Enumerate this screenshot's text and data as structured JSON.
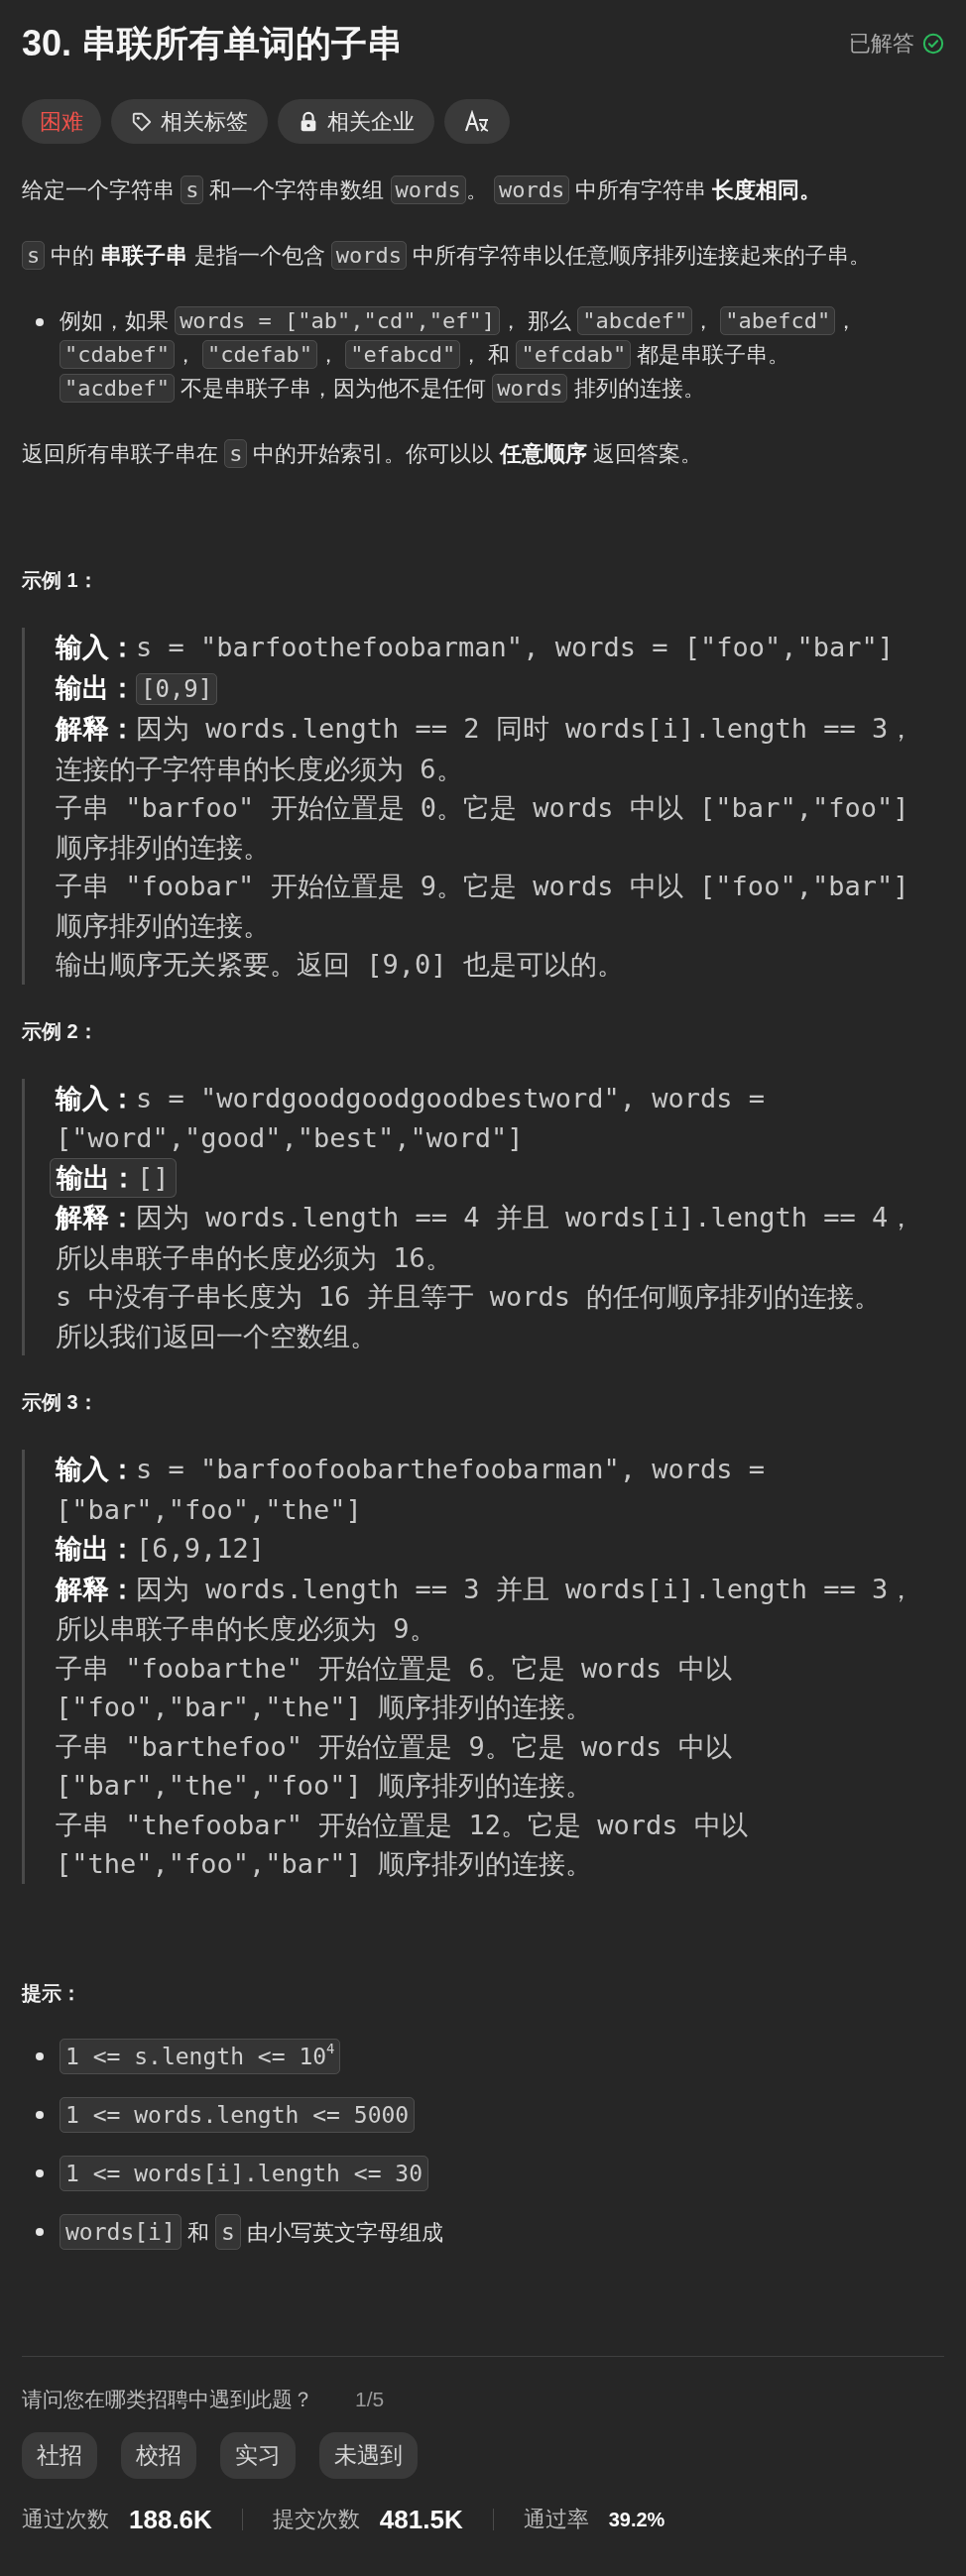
{
  "title": "30. 串联所有单词的子串",
  "status": "已解答",
  "tags": [
    {
      "kind": "difficulty",
      "label": "困难"
    },
    {
      "kind": "topics",
      "label": "相关标签"
    },
    {
      "kind": "companies",
      "label": "相关企业"
    },
    {
      "kind": "translate"
    }
  ],
  "description": [
    {
      "kind": "paragraph",
      "segments": [
        {
          "kind": "text",
          "text": "给定一个字符串 "
        },
        {
          "kind": "code",
          "text": "s"
        },
        {
          "kind": "text",
          "text": " 和一个字符串数组 "
        },
        {
          "kind": "code",
          "text": "words"
        },
        {
          "kind": "text",
          "text": "。 "
        },
        {
          "kind": "code",
          "text": "words"
        },
        {
          "kind": "text",
          "text": " 中所有字符串 "
        },
        {
          "kind": "bold",
          "text": "长度相同。"
        }
      ]
    },
    {
      "kind": "paragraph",
      "segments": [
        {
          "kind": "code",
          "text": "s"
        },
        {
          "kind": "text",
          "text": " 中的 "
        },
        {
          "kind": "bold",
          "text": "串联子串"
        },
        {
          "kind": "text",
          "text": " 是指一个包含 "
        },
        {
          "kind": "code",
          "text": "words"
        },
        {
          "kind": "text",
          "text": " 中所有字符串以任意顺序排列连接起来的子串。"
        }
      ]
    },
    {
      "kind": "bullet",
      "segments": [
        {
          "kind": "text",
          "text": "例如，如果 "
        },
        {
          "kind": "code",
          "text": "words = [\"ab\",\"cd\",\"ef\"]"
        },
        {
          "kind": "text",
          "text": "， 那么 "
        },
        {
          "kind": "code",
          "text": "\"abcdef\""
        },
        {
          "kind": "text",
          "text": "， "
        },
        {
          "kind": "code",
          "text": "\"abefcd\""
        },
        {
          "kind": "text",
          "text": "， "
        },
        {
          "kind": "code",
          "text": "\"cdabef\""
        },
        {
          "kind": "text",
          "text": "， "
        },
        {
          "kind": "code",
          "text": "\"cdefab\""
        },
        {
          "kind": "text",
          "text": "， "
        },
        {
          "kind": "code",
          "text": "\"efabcd\""
        },
        {
          "kind": "text",
          "text": "， 和 "
        },
        {
          "kind": "code",
          "text": "\"efcdab\""
        },
        {
          "kind": "text",
          "text": " 都是串联子串。 "
        },
        {
          "kind": "code",
          "text": "\"acdbef\""
        },
        {
          "kind": "text",
          "text": " 不是串联子串，因为他不是任何 "
        },
        {
          "kind": "code",
          "text": "words"
        },
        {
          "kind": "text",
          "text": " 排列的连接。"
        }
      ]
    },
    {
      "kind": "paragraph",
      "segments": [
        {
          "kind": "text",
          "text": "返回所有串联子串在 "
        },
        {
          "kind": "code",
          "text": "s"
        },
        {
          "kind": "text",
          "text": " 中的开始索引。你可以以 "
        },
        {
          "kind": "bold",
          "text": "任意顺序"
        },
        {
          "kind": "text",
          "text": " 返回答案。"
        }
      ]
    }
  ],
  "examples": [
    {
      "heading": "示例 1：",
      "lines": [
        {
          "kind": "plain",
          "segments": [
            {
              "kind": "label",
              "text": "输入："
            },
            {
              "kind": "text",
              "text": "s = \"barfoothefoobarman\", words = [\"foo\",\"bar\"]"
            }
          ]
        },
        {
          "kind": "plain",
          "segments": [
            {
              "kind": "label",
              "text": "输出："
            },
            {
              "kind": "code",
              "text": "[0,9]"
            }
          ]
        },
        {
          "kind": "plain",
          "segments": [
            {
              "kind": "label",
              "text": "解释："
            },
            {
              "kind": "text",
              "text": "因为 words.length == 2 同时 words[i].length == 3，"
            }
          ]
        },
        {
          "kind": "plain",
          "segments": [
            {
              "kind": "text",
              "text": "连接的子字符串的长度必须为 6。"
            }
          ]
        },
        {
          "kind": "plain",
          "segments": [
            {
              "kind": "text",
              "text": "子串 \"barfoo\" 开始位置是 0。它是 words 中以 [\"bar\",\"foo\"]"
            }
          ]
        },
        {
          "kind": "plain",
          "segments": [
            {
              "kind": "text",
              "text": "顺序排列的连接。"
            }
          ]
        },
        {
          "kind": "plain",
          "segments": [
            {
              "kind": "text",
              "text": "子串 \"foobar\" 开始位置是 9。它是 words 中以 [\"foo\",\"bar\"]"
            }
          ]
        },
        {
          "kind": "plain",
          "segments": [
            {
              "kind": "text",
              "text": "顺序排列的连接。"
            }
          ]
        },
        {
          "kind": "plain",
          "segments": [
            {
              "kind": "text",
              "text": "输出顺序无关紧要。返回 [9,0] 也是可以的。"
            }
          ]
        }
      ]
    },
    {
      "heading": "示例 2：",
      "lines": [
        {
          "kind": "plain",
          "segments": [
            {
              "kind": "label",
              "text": "输入："
            },
            {
              "kind": "text",
              "text": "s = \"wordgoodgoodgoodbestword\", words ="
            }
          ]
        },
        {
          "kind": "plain",
          "segments": [
            {
              "kind": "text",
              "text": "[\"word\",\"good\",\"best\",\"word\"]"
            }
          ]
        },
        {
          "kind": "boxed",
          "segments": [
            {
              "kind": "label",
              "text": "输出："
            },
            {
              "kind": "text",
              "text": "[]"
            }
          ]
        },
        {
          "kind": "plain",
          "segments": [
            {
              "kind": "label",
              "text": "解释："
            },
            {
              "kind": "text",
              "text": "因为 words.length == 4 并且 words[i].length == 4，"
            }
          ]
        },
        {
          "kind": "plain",
          "segments": [
            {
              "kind": "text",
              "text": "所以串联子串的长度必须为 16。"
            }
          ]
        },
        {
          "kind": "plain",
          "segments": [
            {
              "kind": "text",
              "text": "s 中没有子串长度为 16 并且等于 words 的任何顺序排列的连接。"
            }
          ]
        },
        {
          "kind": "plain",
          "segments": [
            {
              "kind": "text",
              "text": "所以我们返回一个空数组。"
            }
          ]
        }
      ]
    },
    {
      "heading": "示例 3：",
      "lines": [
        {
          "kind": "plain",
          "segments": [
            {
              "kind": "label",
              "text": "输入："
            },
            {
              "kind": "text",
              "text": "s = \"barfoofoobarthefoobarman\", words ="
            }
          ]
        },
        {
          "kind": "plain",
          "segments": [
            {
              "kind": "text",
              "text": "[\"bar\",\"foo\",\"the\"]"
            }
          ]
        },
        {
          "kind": "plain",
          "segments": [
            {
              "kind": "label",
              "text": "输出："
            },
            {
              "kind": "text",
              "text": "[6,9,12]"
            }
          ]
        },
        {
          "kind": "plain",
          "segments": [
            {
              "kind": "label",
              "text": "解释："
            },
            {
              "kind": "text",
              "text": "因为 words.length == 3 并且 words[i].length == 3，"
            }
          ]
        },
        {
          "kind": "plain",
          "segments": [
            {
              "kind": "text",
              "text": "所以串联子串的长度必须为 9。"
            }
          ]
        },
        {
          "kind": "plain",
          "segments": [
            {
              "kind": "text",
              "text": "子串 \"foobarthe\" 开始位置是 6。它是 words 中以"
            }
          ]
        },
        {
          "kind": "plain",
          "segments": [
            {
              "kind": "text",
              "text": "[\"foo\",\"bar\",\"the\"] 顺序排列的连接。"
            }
          ]
        },
        {
          "kind": "plain",
          "segments": [
            {
              "kind": "text",
              "text": "子串 \"barthefoo\" 开始位置是 9。它是 words 中以"
            }
          ]
        },
        {
          "kind": "plain",
          "segments": [
            {
              "kind": "text",
              "text": "[\"bar\",\"the\",\"foo\"] 顺序排列的连接。"
            }
          ]
        },
        {
          "kind": "plain",
          "segments": [
            {
              "kind": "text",
              "text": "子串 \"thefoobar\" 开始位置是 12。它是 words 中以"
            }
          ]
        },
        {
          "kind": "plain",
          "segments": [
            {
              "kind": "text",
              "text": "[\"the\",\"foo\",\"bar\"] 顺序排列的连接。"
            }
          ]
        }
      ]
    }
  ],
  "constraints": {
    "heading": "提示：",
    "items": [
      {
        "segments": [
          {
            "kind": "code",
            "text": "1 <= s.length <= 10$^{4}$"
          }
        ]
      },
      {
        "segments": [
          {
            "kind": "code",
            "text": "1 <= words.length <= 5000"
          }
        ]
      },
      {
        "segments": [
          {
            "kind": "code",
            "text": "1 <= words[i].length <= 30"
          }
        ]
      },
      {
        "segments": [
          {
            "kind": "code",
            "text": "words[i]"
          },
          {
            "kind": "text",
            "text": " 和 "
          },
          {
            "kind": "code",
            "text": "s"
          },
          {
            "kind": "text",
            "text": " 由小写英文字母组成"
          }
        ]
      }
    ]
  },
  "survey": {
    "question": "请问您在哪类招聘中遇到此题？",
    "page": "1/5",
    "options": [
      "社招",
      "校招",
      "实习",
      "未遇到"
    ]
  },
  "stats": [
    {
      "kind": "count",
      "label": "通过次数",
      "value": "188.6K"
    },
    {
      "kind": "count",
      "label": "提交次数",
      "value": "481.5K"
    },
    {
      "kind": "rate",
      "label": "通过率",
      "value": "39.2%"
    }
  ]
}
